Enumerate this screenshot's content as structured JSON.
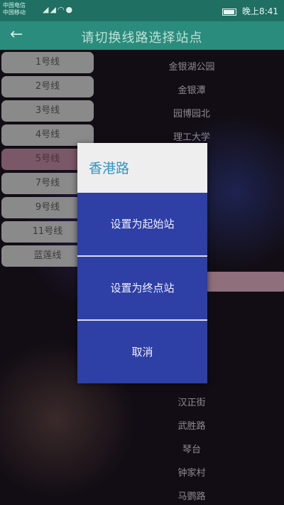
{
  "status_bar": {
    "carrier_1": "中国电信",
    "carrier_2": "中国移动",
    "time": "晚上8:41",
    "battery_level": 0.95
  },
  "app_bar": {
    "back_icon": "back-arrow-icon",
    "title": "请切换线路选择站点"
  },
  "lines": [
    {
      "label": "1号线"
    },
    {
      "label": "2号线"
    },
    {
      "label": "3号线"
    },
    {
      "label": "4号线"
    },
    {
      "label": "5号线"
    },
    {
      "label": "7号线"
    },
    {
      "label": "9号线"
    },
    {
      "label": "11号线"
    },
    {
      "label": "蓝莲线"
    }
  ],
  "stations_top": [
    "金银湖公园",
    "金银潭",
    "园博园北",
    "理工大学"
  ],
  "stations_bottom": [
    "汉正街",
    "武胜路",
    "琴台",
    "钟家村",
    "马鹦路"
  ],
  "dialog": {
    "title": "香港路",
    "set_start": "设置为起始站",
    "set_end": "设置为终点站",
    "cancel": "取消"
  }
}
